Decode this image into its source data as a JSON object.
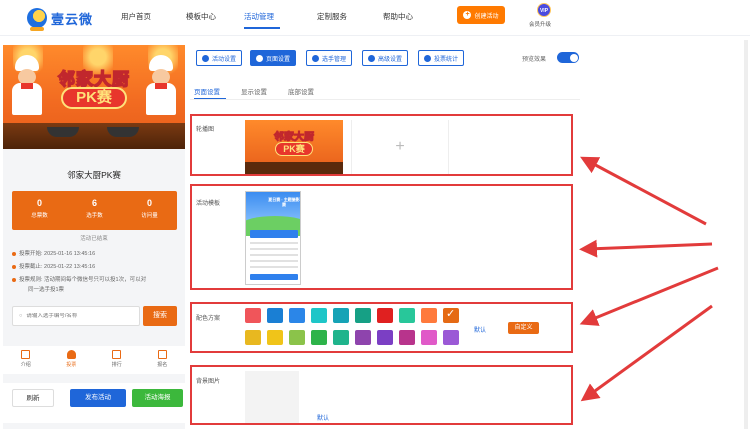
{
  "header": {
    "brand": "壹云微",
    "nav": [
      "用户首页",
      "模板中心",
      "活动管理",
      "定制服务",
      "帮助中心"
    ],
    "active_nav": "活动管理",
    "create_button": "创建活动",
    "vip_badge": "VIP",
    "vip_label": "会员升级"
  },
  "preview": {
    "banner_title_line1": "邻家大厨",
    "banner_title_line2": "PK赛",
    "activity_name": "邻家大厨PK赛",
    "stats": [
      {
        "value": "0",
        "label": "总票数"
      },
      {
        "value": "6",
        "label": "选手数"
      },
      {
        "value": "0",
        "label": "访问量"
      }
    ],
    "status": "活动已结束",
    "info": [
      "投票开始: 2025-01-16 13:45:16",
      "投票截止: 2025-01-22 13:45:16",
      "投票规则: 活动期间每个微信号只可以投1次，可以对",
      "同一选手投1票"
    ],
    "search_placeholder": "请输入选手编号/名称",
    "search_button": "搜索",
    "tabs": [
      "介绍",
      "投票",
      "排行",
      "报名"
    ],
    "active_tab": "投票",
    "buttons": {
      "refresh": "刷新",
      "publish": "发布活动",
      "poster": "活动海报"
    }
  },
  "toolbar": {
    "buttons": [
      "活动设置",
      "页面设置",
      "选手管理",
      "高级设置",
      "投票统计"
    ],
    "active": "页面设置",
    "preview_label": "预览效果",
    "preview_on": true
  },
  "subtabs": [
    "页面设置",
    "显示设置",
    "底部设置"
  ],
  "active_subtab": "页面设置",
  "sections": {
    "carousel": {
      "label": "轮播图",
      "thumb_line1": "邻家大厨",
      "thumb_line2": "PK赛",
      "add_icon": "+"
    },
    "template": {
      "label": "活动模板",
      "thumb_title": "夏日赛 · 主题摄影赛"
    },
    "colors": {
      "label": "配色方案",
      "row1": [
        "#f0555a",
        "#1a7fd4",
        "#2b86e8",
        "#1ec6c8",
        "#16a3b6",
        "#16a085",
        "#e02020",
        "#28c79a",
        "#ff7a3c",
        "#e56a14"
      ],
      "row2": [
        "#e8b820",
        "#f0c419",
        "#8bc34a",
        "#2db34a",
        "#1fb48c",
        "#8e44ad",
        "#7b3fc4",
        "#b8348c",
        "#e05ac8",
        "#9b59d6"
      ],
      "selected_index": 9,
      "default_label": "默认",
      "custom_label": "自定义"
    },
    "background": {
      "label": "背景图片",
      "default_label": "默认"
    }
  },
  "accent_color": "#1f66d9",
  "theme_color": "#e96a14",
  "annotation_color": "#e23b3b"
}
